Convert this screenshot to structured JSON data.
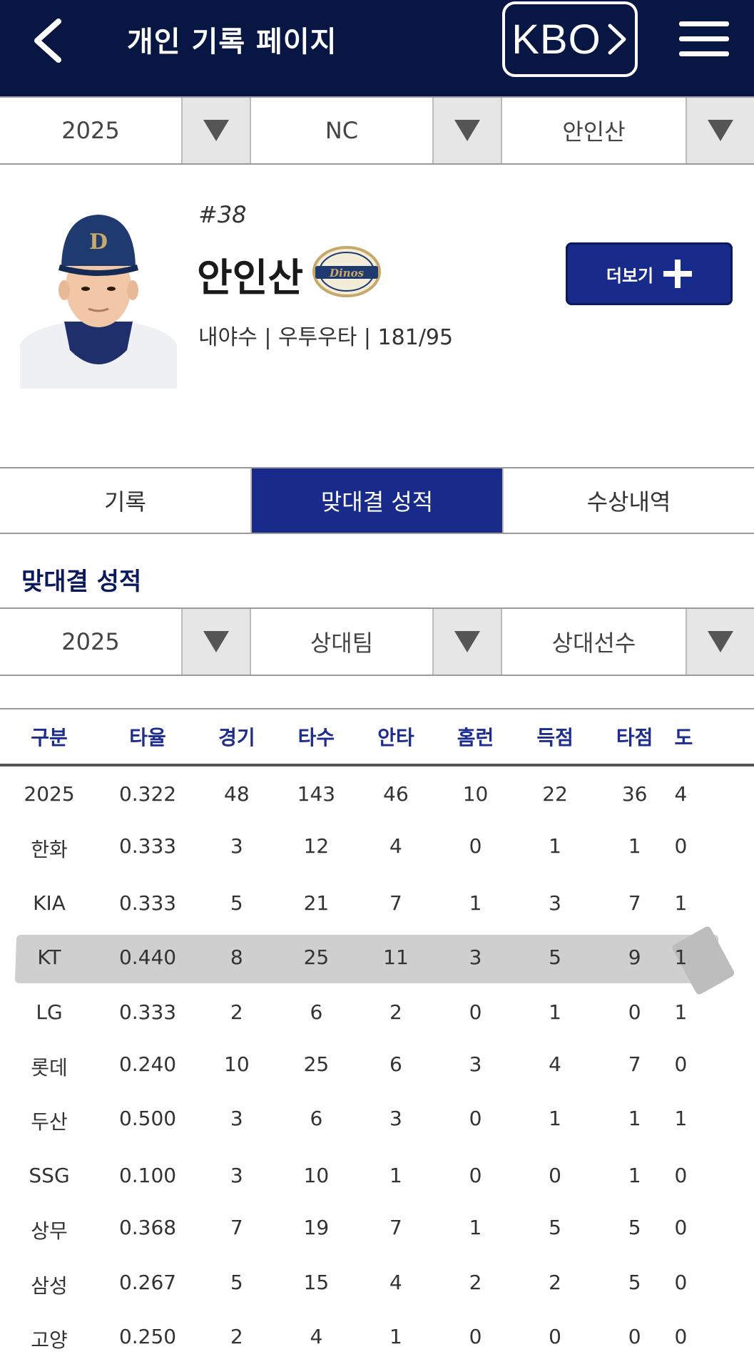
{
  "header": {
    "title": "개인 기록 페이지",
    "kbo_label": "KBO"
  },
  "filters": {
    "year": "2025",
    "team": "NC",
    "player": "안인산"
  },
  "player": {
    "number": "#38",
    "name": "안인산",
    "info": "내야수 | 우투우타 | 181/95",
    "team_logo_text": "Dinos"
  },
  "more_button": {
    "label": "더보기"
  },
  "tabs": [
    {
      "label": "기록",
      "active": false
    },
    {
      "label": "맞대결 성적",
      "active": true
    },
    {
      "label": "수상내역",
      "active": false
    }
  ],
  "section": {
    "title": "맞대결 성적"
  },
  "matchup_filters": {
    "year": "2025",
    "opponent_team": "상대팀",
    "opponent_player": "상대선수"
  },
  "table": {
    "headers": [
      "구분",
      "타율",
      "경기",
      "타수",
      "안타",
      "홈런",
      "득점",
      "타점",
      "도"
    ],
    "rows": [
      [
        "2025",
        "0.322",
        "48",
        "143",
        "46",
        "10",
        "22",
        "36",
        "4"
      ],
      [
        "한화",
        "0.333",
        "3",
        "12",
        "4",
        "0",
        "1",
        "1",
        "0"
      ],
      [
        "KIA",
        "0.333",
        "5",
        "21",
        "7",
        "1",
        "3",
        "7",
        "1"
      ],
      [
        "KT",
        "0.440",
        "8",
        "25",
        "11",
        "3",
        "5",
        "9",
        "1"
      ],
      [
        "LG",
        "0.333",
        "2",
        "6",
        "2",
        "0",
        "1",
        "0",
        "1"
      ],
      [
        "롯데",
        "0.240",
        "10",
        "25",
        "6",
        "3",
        "4",
        "7",
        "0"
      ],
      [
        "두산",
        "0.500",
        "3",
        "6",
        "3",
        "0",
        "1",
        "1",
        "1"
      ],
      [
        "SSG",
        "0.100",
        "3",
        "10",
        "1",
        "0",
        "0",
        "1",
        "0"
      ],
      [
        "상무",
        "0.368",
        "7",
        "19",
        "7",
        "1",
        "5",
        "5",
        "0"
      ],
      [
        "삼성",
        "0.267",
        "5",
        "15",
        "4",
        "2",
        "2",
        "5",
        "0"
      ],
      [
        "고양",
        "0.250",
        "2",
        "4",
        "1",
        "0",
        "0",
        "0",
        "0"
      ]
    ],
    "highlighted_row": "KT"
  },
  "colors": {
    "header_bg": "#071643",
    "accent": "#182a8a",
    "table_header_text": "#1d2c8f",
    "highlight": "#cfcfcf"
  }
}
